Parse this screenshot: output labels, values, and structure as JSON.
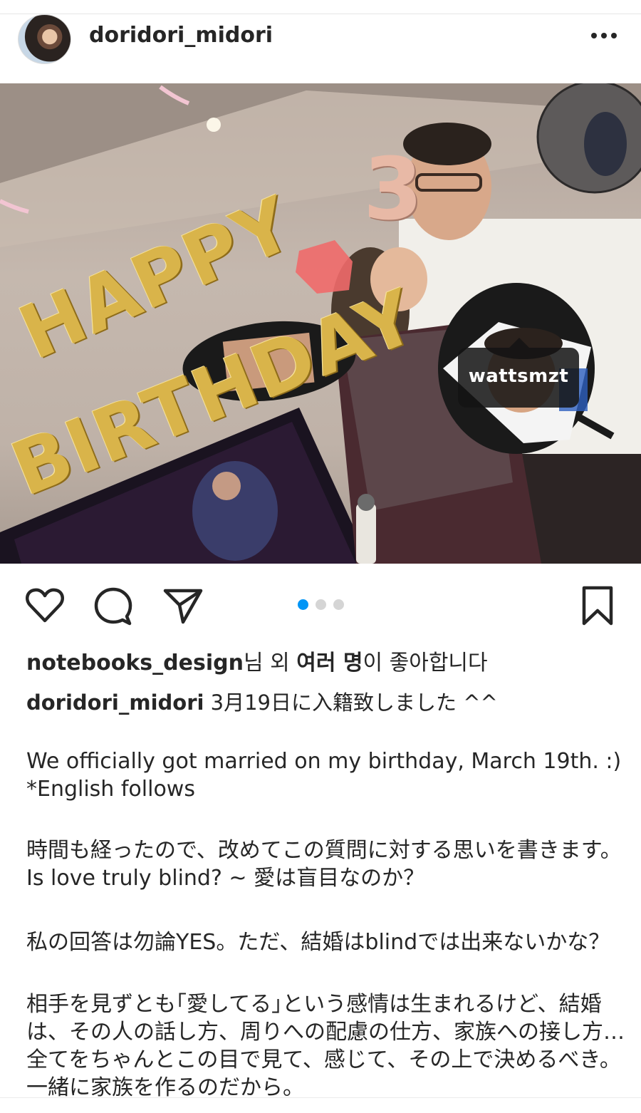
{
  "header": {
    "username": "doridori_midori"
  },
  "photo": {
    "balloons_line1": "HAPPY",
    "balloons_line2": "BIRTHDAY",
    "number_balloon": "3",
    "tag_username": "wattsmzt"
  },
  "carousel": {
    "total": 3,
    "active": 1,
    "active_color": "#0095f6"
  },
  "likes": {
    "user": "notebooks_design",
    "suffix_1": "님 외 ",
    "others": "여러 명",
    "suffix_2": "이 좋아합니다"
  },
  "caption": {
    "username": "doridori_midori",
    "first_line": " 3月19日に入籍致しました ^^",
    "paragraphs": [
      "We officially got married on my birthday, March 19th. :)　*English follows",
      "時間も経ったので、改めてこの質問に対する思いを書きます。Is love truly blind? ~ 愛は盲目なのか？",
      "私の回答は勿論YES。ただ、結婚はblindでは出来ないかな？",
      "相手を見ずとも｢愛してる｣という感情は生まれるけど、結婚は、その人の話し方、周りへの配慮の仕方、家族への接し方…全てをちゃんとこの目で見て、感じて、その上で決めるべき。一緒に家族を作るのだから。"
    ]
  },
  "icons": {
    "more": "more-options-icon",
    "like": "heart-icon",
    "comment": "comment-icon",
    "share": "share-icon",
    "save": "bookmark-icon",
    "user_tag": "user-tag-icon"
  }
}
